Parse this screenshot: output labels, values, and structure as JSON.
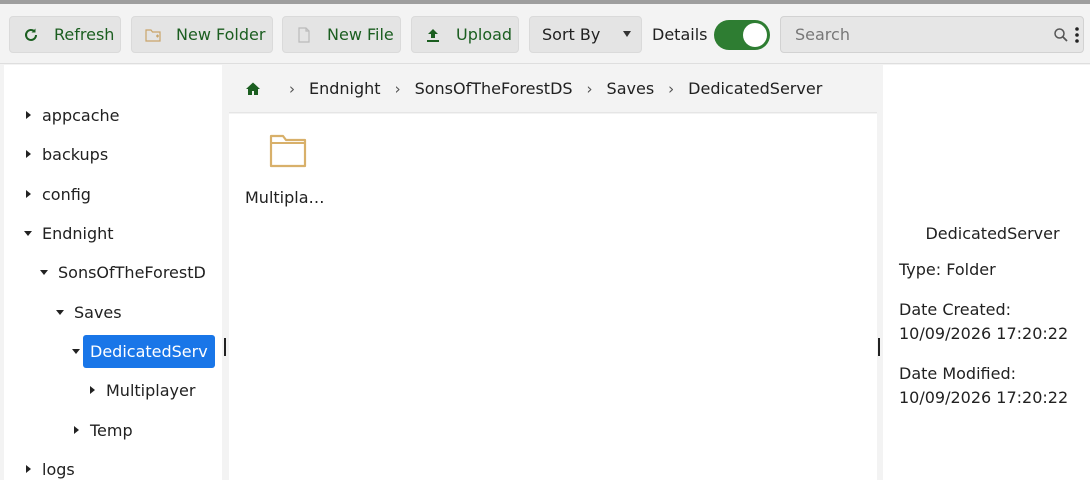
{
  "toolbar": {
    "refresh_label": "Refresh",
    "new_folder_label": "New Folder",
    "new_file_label": "New File",
    "upload_label": "Upload",
    "sort_label": "Sort By",
    "details_label": "Details",
    "details_enabled": true,
    "search_placeholder": "Search"
  },
  "colors": {
    "accent_green": "#1b5e20",
    "toggle_green": "#2e7d32",
    "selected_blue": "#1976e8",
    "folder_tan": "#d8b06a"
  },
  "tree": {
    "items": [
      {
        "label": "appcache",
        "expanded": false,
        "level": 0
      },
      {
        "label": "backups",
        "expanded": false,
        "level": 0
      },
      {
        "label": "config",
        "expanded": false,
        "level": 0
      },
      {
        "label": "Endnight",
        "expanded": true,
        "level": 0
      },
      {
        "label": "SonsOfTheForestD",
        "expanded": true,
        "level": 1
      },
      {
        "label": "Saves",
        "expanded": true,
        "level": 2
      },
      {
        "label": "DedicatedServ",
        "expanded": true,
        "level": 3,
        "selected": true
      },
      {
        "label": "Multiplayer",
        "expanded": false,
        "level": 4
      },
      {
        "label": "Temp",
        "expanded": false,
        "level": 3
      },
      {
        "label": "logs",
        "expanded": false,
        "level": 0
      }
    ]
  },
  "breadcrumb": {
    "home_icon": "home-icon",
    "items": [
      "Endnight",
      "SonsOfTheForestDS",
      "Saves",
      "DedicatedServer"
    ],
    "separator": "›"
  },
  "content": {
    "files": [
      {
        "name": "Multipla…",
        "icon": "folder-icon"
      }
    ]
  },
  "details": {
    "name": "DedicatedServer",
    "type": "Type: Folder",
    "created_label": "Date Created:",
    "created_value": "10/09/2026 17:20:22",
    "modified_label": "Date Modified:",
    "modified_value": "10/09/2026 17:20:22"
  }
}
